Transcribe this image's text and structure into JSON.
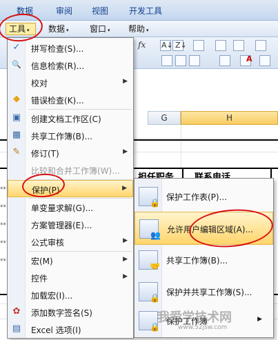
{
  "ribbon": {
    "tabs": [
      "数据",
      "审阅",
      "视图",
      "开发工具"
    ]
  },
  "menubar": {
    "items": [
      {
        "label": "工具",
        "arrow": "▾"
      },
      {
        "label": "数据",
        "arrow": "▾"
      },
      {
        "label": "窗口",
        "arrow": "▾"
      },
      {
        "label": "帮助",
        "arrow": "▾"
      }
    ]
  },
  "toolbar": {
    "fx": "fx",
    "sort_az": "A↓",
    "sort_za": "Z↓",
    "font_color_glyph": "A"
  },
  "sheet": {
    "col_headers": [
      "G",
      "H"
    ],
    "header_cells": [
      "担任职务",
      "联系电话"
    ],
    "row_marks": [
      "**",
      "**",
      "**",
      "**",
      "**"
    ]
  },
  "tools_menu": {
    "items": [
      {
        "label": "拼写检查(S)...",
        "icon": "spellcheck-icon",
        "glyph": "✓",
        "has_submenu": false,
        "disabled": false
      },
      {
        "label": "信息检索(R)...",
        "icon": "research-icon",
        "glyph": "🔍",
        "has_submenu": false,
        "disabled": false
      },
      {
        "label": "校对",
        "icon": "",
        "glyph": "",
        "has_submenu": true,
        "disabled": false
      },
      {
        "label": "错误检查(K)...",
        "icon": "error-check-icon",
        "glyph": "◆",
        "has_submenu": false,
        "disabled": false
      },
      {
        "label": "创建文档工作区(C)",
        "icon": "workspace-icon",
        "glyph": "▣",
        "has_submenu": false,
        "disabled": false
      },
      {
        "label": "共享工作簿(B)...",
        "icon": "share-workbook-icon",
        "glyph": "▦",
        "has_submenu": false,
        "disabled": false
      },
      {
        "label": "修订(T)",
        "icon": "track-changes-icon",
        "glyph": "✎",
        "has_submenu": true,
        "disabled": false
      },
      {
        "label": "比较和合并工作簿(W)...",
        "icon": "",
        "glyph": "",
        "has_submenu": false,
        "disabled": true
      },
      {
        "label": "保护(P)",
        "icon": "",
        "glyph": "",
        "has_submenu": true,
        "disabled": false
      },
      {
        "label": "单变量求解(G)...",
        "icon": "",
        "glyph": "",
        "has_submenu": false,
        "disabled": false
      },
      {
        "label": "方案管理器(E)...",
        "icon": "",
        "glyph": "",
        "has_submenu": false,
        "disabled": false
      },
      {
        "label": "公式审核",
        "icon": "",
        "glyph": "",
        "has_submenu": true,
        "disabled": false
      },
      {
        "label": "宏(M)",
        "icon": "",
        "glyph": "",
        "has_submenu": true,
        "disabled": false
      },
      {
        "label": "控件",
        "icon": "",
        "glyph": "",
        "has_submenu": true,
        "disabled": false
      },
      {
        "label": "加载宏(I)...",
        "icon": "",
        "glyph": "",
        "has_submenu": false,
        "disabled": false
      },
      {
        "label": "添加数字签名(S)",
        "icon": "signature-icon",
        "glyph": "✿",
        "has_submenu": false,
        "disabled": false
      },
      {
        "label": "Excel 选项(I)",
        "icon": "excel-options-icon",
        "glyph": "▤",
        "has_submenu": false,
        "disabled": false
      }
    ],
    "submenu_arrow": "▶"
  },
  "protect_submenu": {
    "items": [
      {
        "label": "保护工作表(P)...",
        "icon": "protect-sheet-icon",
        "overlay": "🔒",
        "has_submenu": false
      },
      {
        "label": "允许用户编辑区域(A)...",
        "icon": "allow-edit-ranges-icon",
        "overlay": "👥",
        "has_submenu": false
      },
      {
        "label": "共享工作簿(B)...",
        "icon": "share-workbook-icon",
        "overlay": "🤝",
        "has_submenu": false
      },
      {
        "label": "保护并共享工作簿(S)...",
        "icon": "protect-share-workbook-icon",
        "overlay": "🔒",
        "has_submenu": false
      },
      {
        "label": "保护工作簿",
        "icon": "protect-workbook-icon",
        "overlay": "🔒",
        "has_submenu": true
      }
    ],
    "submenu_arrow": "▶"
  },
  "watermark": {
    "text": "我爱学技术网",
    "url": "www.52jsw.com"
  },
  "colors": {
    "highlight": "#ffd56b",
    "annotation": "#d81010",
    "ribbon": "#c4d7ef"
  }
}
